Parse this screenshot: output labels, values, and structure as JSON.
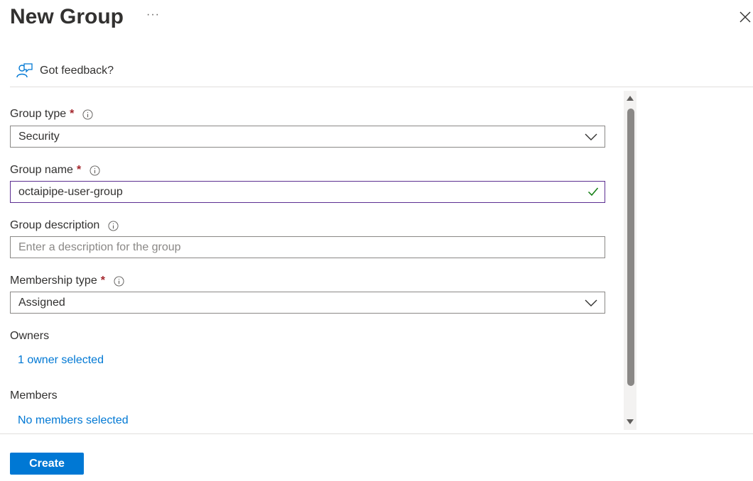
{
  "header": {
    "title": "New Group",
    "more_label": "···"
  },
  "feedback": {
    "label": "Got feedback?"
  },
  "form": {
    "group_type": {
      "label": "Group type",
      "required": "*",
      "value": "Security"
    },
    "group_name": {
      "label": "Group name",
      "required": "*",
      "value": "octaipipe-user-group"
    },
    "group_description": {
      "label": "Group description",
      "placeholder": "Enter a description for the group"
    },
    "membership_type": {
      "label": "Membership type",
      "required": "*",
      "value": "Assigned"
    },
    "owners": {
      "label": "Owners",
      "link": "1 owner selected"
    },
    "members": {
      "label": "Members",
      "link": "No members selected"
    }
  },
  "footer": {
    "create_label": "Create"
  },
  "colors": {
    "accent": "#0078d4",
    "required": "#a4262c",
    "valid": "#107c10",
    "focus": "#5c2e91"
  }
}
